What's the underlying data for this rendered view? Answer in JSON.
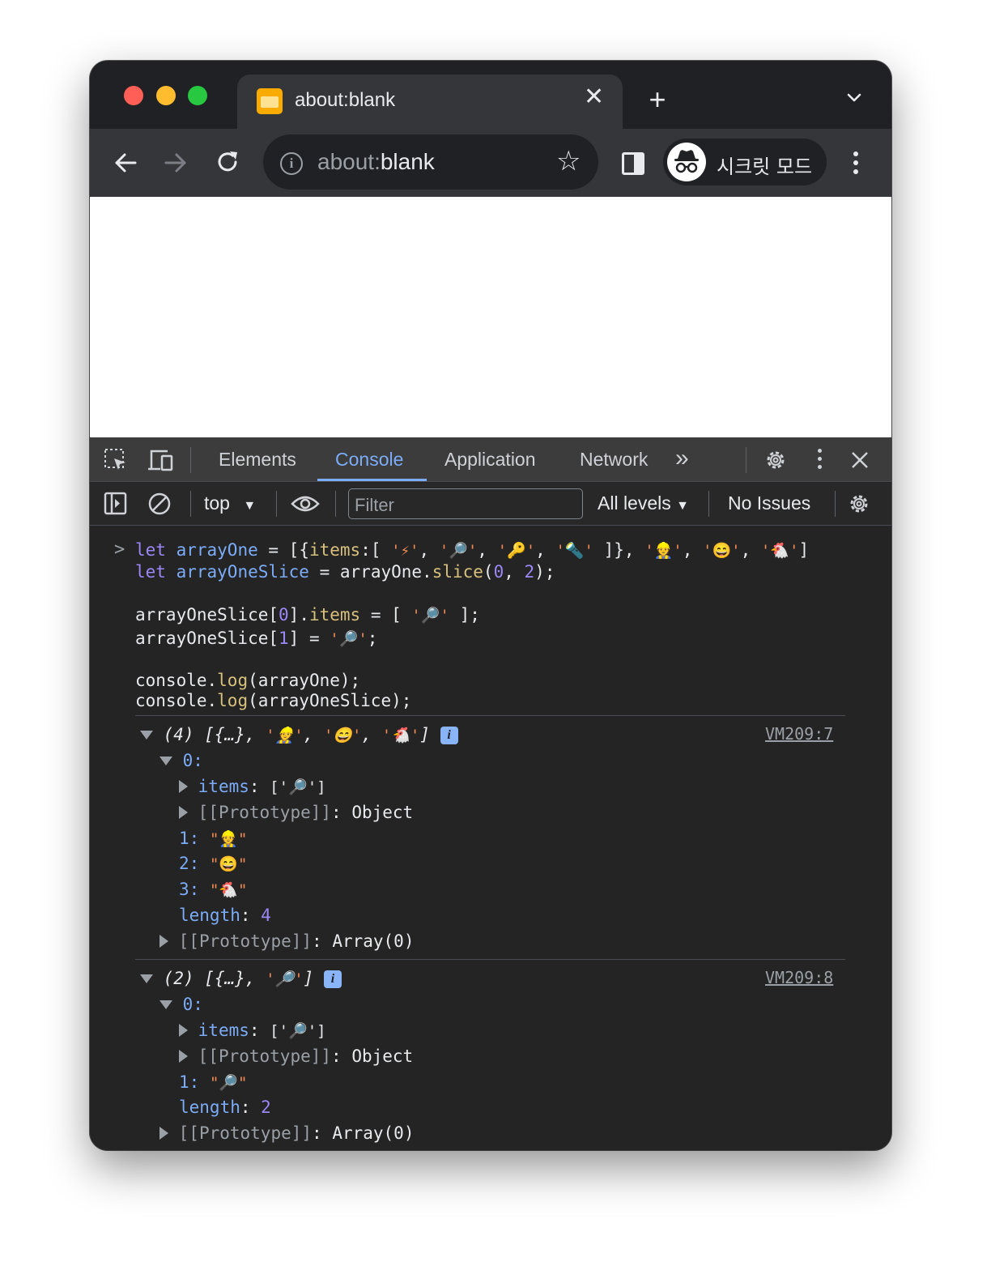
{
  "tab": {
    "title": "about:blank",
    "close": "✕",
    "new_tab": "+"
  },
  "toolbar": {
    "url_scheme": "about:",
    "url_rest": "blank",
    "profile_label": "시크릿 모드"
  },
  "devtools": {
    "tabs": [
      "Elements",
      "Console",
      "Application",
      "Network"
    ],
    "active_tab": "Console",
    "more": "»",
    "context": "top",
    "filter_placeholder": "Filter",
    "levels": "All levels",
    "issues": "No Issues"
  },
  "console": {
    "prompt": ">",
    "input": {
      "line1": {
        "kw": "let",
        "var": "arrayOne",
        "eq": " = [{",
        "key": "items",
        "rest1": ":[ ",
        "s1": "'⚡'",
        "c1": ", ",
        "s2": "'🔎'",
        "c2": ", ",
        "s3": "'🔑'",
        "c3": ", ",
        "s4": "'🔦'",
        "rest2": " ]}, ",
        "s5": "'👷'",
        "c5": ", ",
        "s6": "'😄'",
        "c6": ", ",
        "s7": "'🐔'",
        "end": "]"
      },
      "line2": {
        "kw": "let",
        "var": "arrayOneSlice",
        "eq": " = arrayOne.",
        "method": "slice",
        "open": "(",
        "n0": "0",
        "comma": ", ",
        "n2": "2",
        "close": ");"
      },
      "line3": {
        "a": "arrayOneSlice[",
        "n": "0",
        "b": "].",
        "key": "items",
        "c": " = [ ",
        "s": "'🔎'",
        "d": " ];"
      },
      "line4": {
        "a": "arrayOneSlice[",
        "n": "1",
        "b": "] = ",
        "s": "'🔎'",
        "d": ";"
      },
      "line5": {
        "a": "console.",
        "m": "log",
        "b": "(arrayOne);"
      },
      "line6": {
        "a": "console.",
        "m": "log",
        "b": "(arrayOneSlice);"
      }
    },
    "outputs": [
      {
        "summary_pre": "(4) [{…}, ",
        "summary_items": [
          {
            "s": "'👷'",
            "sep": ", "
          },
          {
            "s": "'😄'",
            "sep": ", "
          },
          {
            "s": "'🐔'",
            "sep": ""
          }
        ],
        "summary_end": "]",
        "source": "VM209:7",
        "index0": "0:",
        "items_key": "items",
        "items_val": "['🔎']",
        "proto_key": "[[Prototype]]",
        "proto_val": "Object",
        "entries": [
          {
            "k": "1:",
            "v": "\"👷\""
          },
          {
            "k": "2:",
            "v": "\"😄\""
          },
          {
            "k": "3:",
            "v": "\"🐔\""
          }
        ],
        "length_key": "length",
        "length_val": "4",
        "array_proto_key": "[[Prototype]]",
        "array_proto_val": "Array(0)"
      },
      {
        "summary_pre": "(2) [{…}, ",
        "summary_items": [
          {
            "s": "'🔎'",
            "sep": ""
          }
        ],
        "summary_end": "]",
        "source": "VM209:8",
        "index0": "0:",
        "items_key": "items",
        "items_val": "['🔎']",
        "proto_key": "[[Prototype]]",
        "proto_val": "Object",
        "entries": [
          {
            "k": "1:",
            "v": "\"🔎\""
          }
        ],
        "length_key": "length",
        "length_val": "2",
        "array_proto_key": "[[Prototype]]",
        "array_proto_val": "Array(0)"
      }
    ]
  },
  "colors": {
    "keyword": "#9c87f7",
    "variable": "#7cacf8",
    "property": "#d7c17c",
    "string": "#f28b54",
    "accent": "#7cacf8"
  }
}
